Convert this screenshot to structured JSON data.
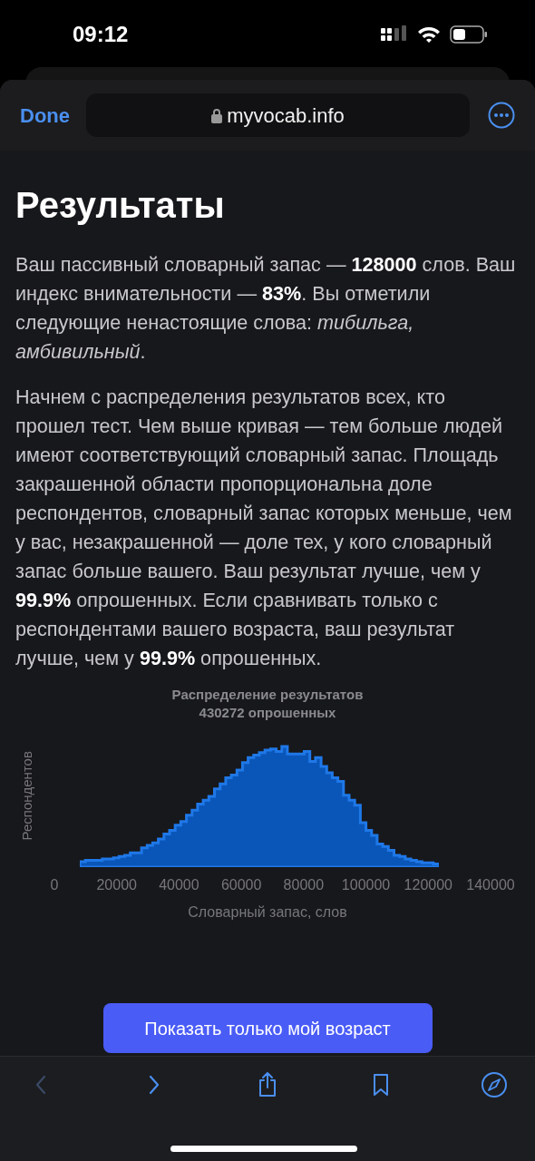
{
  "status_bar": {
    "time": "09:12"
  },
  "browser_bar": {
    "done": "Done",
    "url": "myvocab.info"
  },
  "title": "Результаты",
  "paragraphs": [
    "Ваш пассивный словарный запас — **128000** слов. Ваш индекс внимательности — **83%**. Вы отметили следующие ненастоящие слова: *тибильга, амбивильный*.",
    "Начнем с распределения результатов всех, кто прошел тест. Чем выше кривая — тем больше людей имеют соответствующий словарный запас. Площадь закрашенной области пропорциональна доле респондентов, словарный запас которых меньше, чем у вас, незакрашенной — доле тех, у кого словарный запас больше вашего. Ваш результат лучше, чем у **99.9%** опрошенных. Если сравнивать только с респондентами вашего возраста, ваш результат лучше, чем у **99.9%** опрошенных."
  ],
  "chart": {
    "title": "Распределение результатов",
    "subtitle": "430272 опрошенных",
    "ylabel": "Респондентов",
    "xlabel": "Словарный запас, слов",
    "x_ticks": [
      "0",
      "20000",
      "40000",
      "60000",
      "80000",
      "100000",
      "120000",
      "140000"
    ]
  },
  "age_button": "Показать только мой возраст",
  "toolbar": [
    {
      "kind": "back",
      "disabled": true
    },
    {
      "kind": "forward",
      "disabled": false
    },
    {
      "kind": "share",
      "disabled": false
    },
    {
      "kind": "bookmarks",
      "disabled": false
    },
    {
      "kind": "compass",
      "disabled": false
    }
  ]
}
